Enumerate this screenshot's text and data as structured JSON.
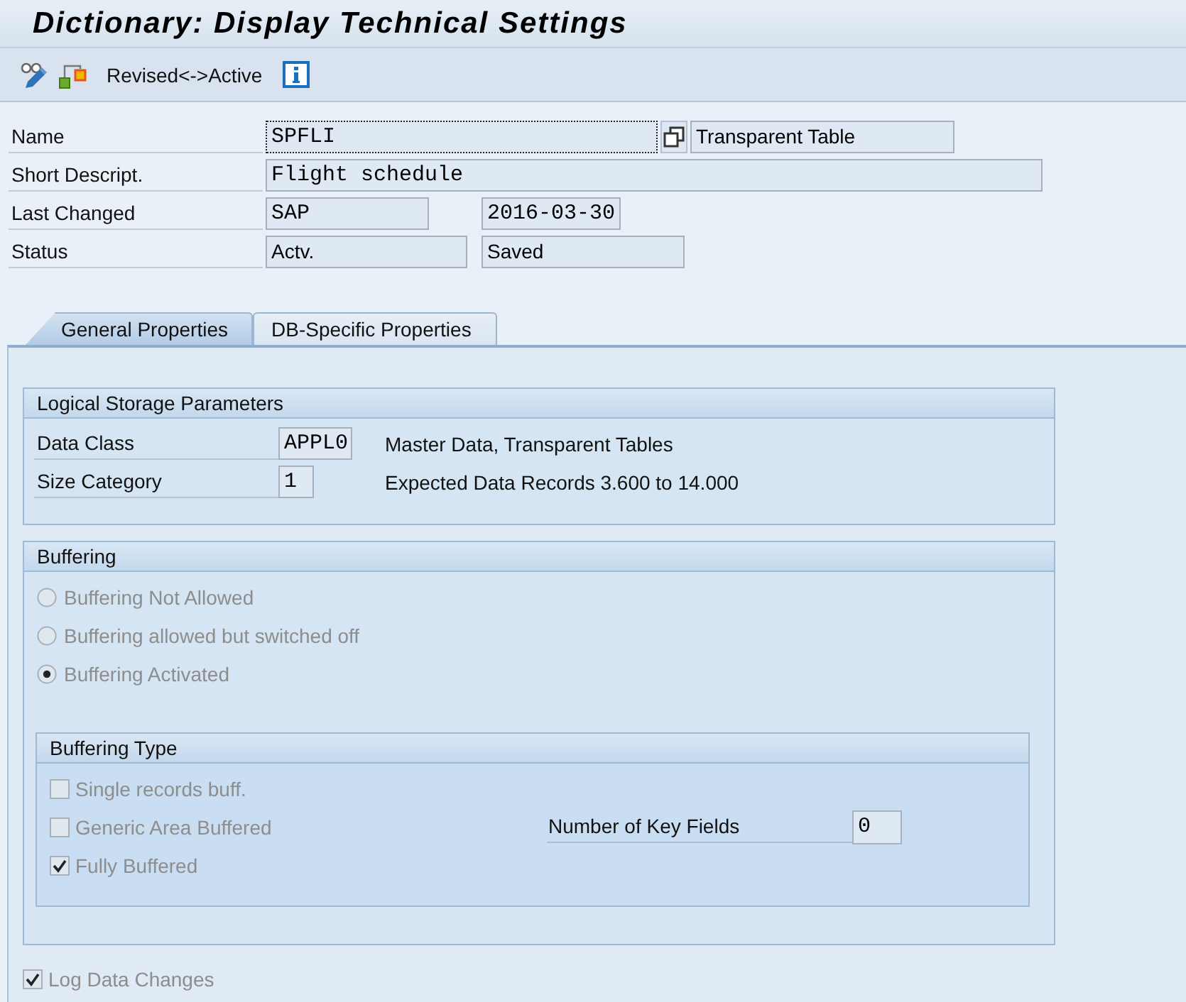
{
  "window": {
    "title": "Dictionary: Display Technical Settings"
  },
  "toolbar": {
    "buttons": [
      {
        "kind": "display_change"
      },
      {
        "kind": "other_version"
      },
      {
        "kind": "text",
        "label": "Revised<->Active"
      },
      {
        "kind": "info"
      }
    ]
  },
  "header": {
    "rows": [
      {
        "label": "Name",
        "fields": [
          {
            "kind": "input",
            "value": "SPFLI",
            "focused": true
          },
          {
            "kind": "details_button",
            "focused": false
          },
          {
            "kind": "output",
            "value": "Transparent Table",
            "focused": false
          }
        ]
      },
      {
        "label": "Short Descript.",
        "fields": [
          {
            "kind": "input",
            "value": "Flight schedule",
            "focused": false
          }
        ]
      },
      {
        "label": "Last Changed",
        "fields": [
          {
            "kind": "input",
            "value": "SAP",
            "focused": false
          },
          {
            "kind": "input",
            "value": "2016-03-30",
            "focused": false
          }
        ]
      },
      {
        "label": "Status",
        "fields": [
          {
            "kind": "output",
            "value": "Actv.",
            "focused": false
          },
          {
            "kind": "output",
            "value": "Saved",
            "focused": false
          }
        ]
      }
    ]
  },
  "tabs": [
    {
      "label": "General Properties",
      "selected": true
    },
    {
      "label": "DB-Specific Properties",
      "selected": false
    }
  ],
  "logical_storage": {
    "title": "Logical Storage Parameters",
    "rows": [
      {
        "label": "Data Class",
        "value": "APPL0",
        "description": "Master Data, Transparent Tables"
      },
      {
        "label": "Size Category",
        "value": "1",
        "description": "Expected Data Records 3.600 to 14.000"
      }
    ]
  },
  "buffering": {
    "title": "Buffering",
    "options": [
      {
        "label": "Buffering Not Allowed",
        "selected": false,
        "disabled": true
      },
      {
        "label": "Buffering allowed but switched off",
        "selected": false,
        "disabled": true
      },
      {
        "label": "Buffering Activated",
        "selected": true,
        "disabled": true
      }
    ],
    "buffering_type": {
      "title": "Buffering Type",
      "options": [
        {
          "label": "Single records buff.",
          "checked": false,
          "disabled": true
        },
        {
          "label": "Generic Area Buffered",
          "checked": false,
          "disabled": true
        },
        {
          "label": "Fully Buffered",
          "checked": true,
          "disabled": true
        }
      ],
      "key_fields": {
        "label": "Number of Key Fields",
        "value": "0"
      }
    }
  },
  "log_data_changes": {
    "label": "Log Data Changes",
    "checked": true,
    "disabled": true
  }
}
